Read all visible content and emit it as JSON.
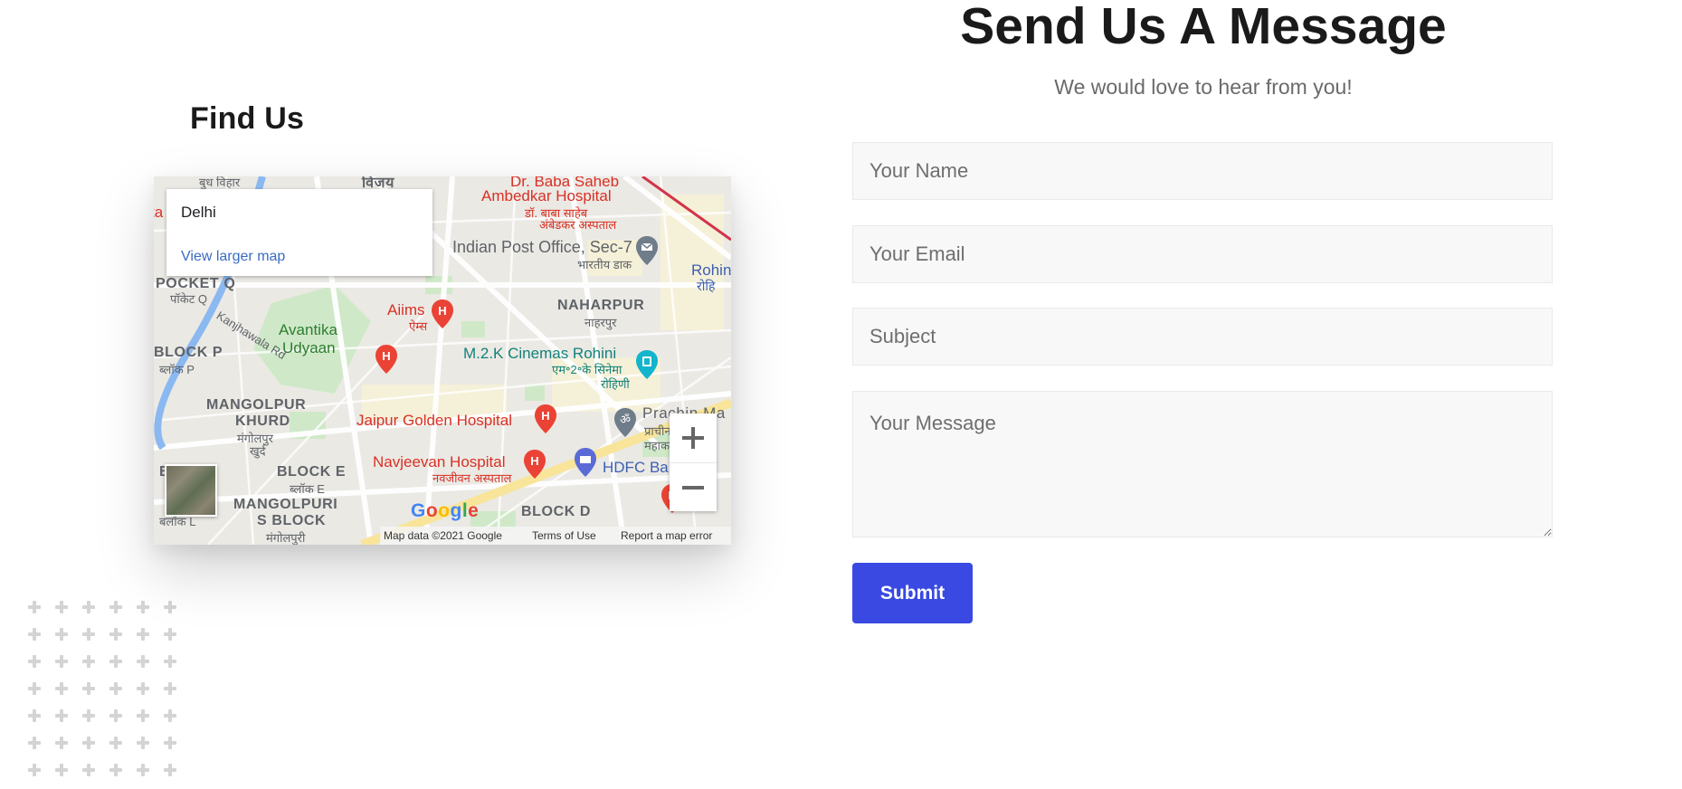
{
  "find_us": {
    "title": "Find Us",
    "map": {
      "info_card": {
        "place": "Delhi",
        "larger_map_link": "View larger map"
      },
      "labels": {
        "pocket_q": "POCKET Q",
        "pocket_q_hi": "पॉकेट Q",
        "budh_vihar": "बुध विहार",
        "vijay": "विजय",
        "baba_saheb": "Dr. Baba Saheb",
        "ambedkar": "Ambedkar Hospital",
        "baba_hi": "डॉ. बाबा साहेब",
        "ambedkar_hi": "अंबेडकर अस्पताल",
        "indian_post": "Indian Post Office, Sec-7",
        "indian_post_hi": "भारतीय डाक",
        "rohini": "Rohin",
        "rohini_hi": "रोहि",
        "naharpur": "NAHARPUR",
        "naharpur_hi": "नाहरपुर",
        "aiims": "Aiims",
        "aiims_hi": "ऐम्स",
        "avantika": "Avantika",
        "udyaan": "Udyaan",
        "kanjhawala": "Kanjhawala Rd",
        "block_p": "BLOCK P",
        "block_p_hi": "ब्लॉक P",
        "m2k": "M.2.K Cinemas Rohini",
        "m2k_hi": "एम॰2॰के सिनेमा",
        "m2k_hi2": "रोहिणी",
        "mangolpur": "MANGOLPUR",
        "khurd": "KHURD",
        "mangolpur_hi": "मंगोलपुर",
        "khurd_hi": "खुर्द",
        "jaipur": "Jaipur Golden Hospital",
        "prachin": "Prachin Ma",
        "prachin_hi": "प्राचीन",
        "prachin_hi2": "महाक",
        "navjeevan": "Navjeevan Hospital",
        "navjeevan_hi": "नवजीवन अस्पताल",
        "hdfc": "HDFC Ba",
        "block_e": "BLOCK E",
        "block_e_hi": "ब्लॉक E",
        "mangolpuri": "MANGOLPURI",
        "s_block": "S BLOCK",
        "mangolpuri_hi": "मंगोलपुरी",
        "block_d": "BLOCK D",
        "block_l": "बलॉक L",
        "bl": "BL",
        "ta": "ta"
      },
      "logo": "Google",
      "attribution": {
        "data": "Map data ©2021 Google",
        "terms": "Terms of Use",
        "report": "Report a map error"
      },
      "controls": {
        "zoom_in": "+",
        "zoom_out": "−"
      }
    }
  },
  "contact_form": {
    "title": "Send Us A Message",
    "subtitle": "We would love to hear from you!",
    "fields": {
      "name_placeholder": "Your Name",
      "email_placeholder": "Your Email",
      "subject_placeholder": "Subject",
      "message_placeholder": "Your Message"
    },
    "submit_label": "Submit"
  },
  "colors": {
    "accent": "#3949e2",
    "heading": "#1a1a1a",
    "field_bg": "#f8f8f8",
    "map_red": "#d93025",
    "map_teal": "#12827a"
  }
}
